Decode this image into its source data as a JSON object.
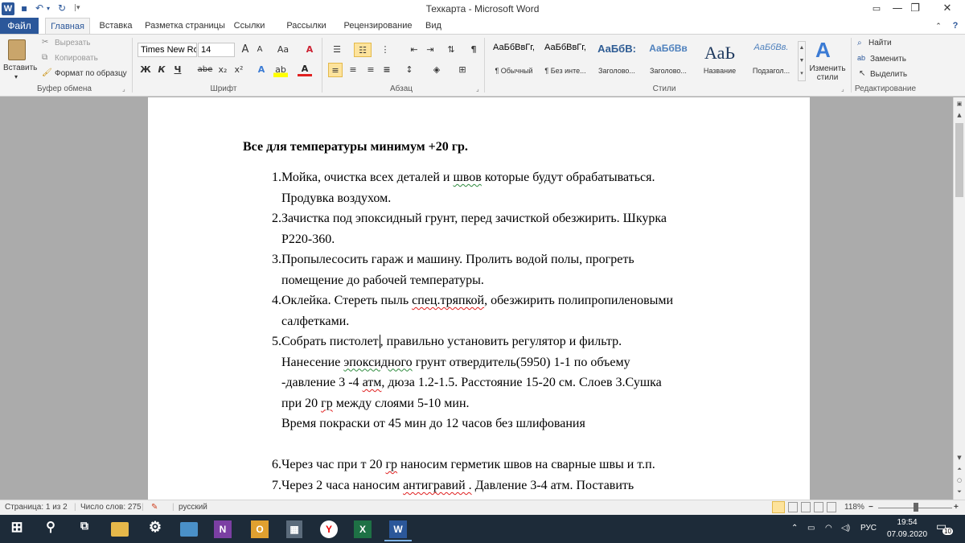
{
  "window": {
    "title": "Техкарта  -  Microsoft Word",
    "app_icon": "word-icon",
    "controls": {
      "help": "?",
      "minimize": "—",
      "restore": "❐",
      "close": "✕"
    }
  },
  "quick_access": {
    "save_icon": "save-icon",
    "undo_icon": "undo-icon",
    "redo_icon": "redo-icon"
  },
  "tabs": [
    "Файл",
    "Главная",
    "Вставка",
    "Разметка страницы",
    "Ссылки",
    "Рассылки",
    "Рецензирование",
    "Вид"
  ],
  "ribbon": {
    "clipboard": {
      "label": "Буфер обмена",
      "paste": "Вставить",
      "cut": "Вырезать",
      "copy": "Копировать",
      "format_painter": "Формат по образцу"
    },
    "font": {
      "label": "Шрифт",
      "font_name": "Times New Ro",
      "font_size": "14",
      "bold": "Ж",
      "italic": "К",
      "underline": "Ч",
      "strike": "abe",
      "subscript": "x₂",
      "superscript": "x²",
      "grow": "A",
      "shrink": "A",
      "case": "Aa",
      "clear": "A"
    },
    "paragraph": {
      "label": "Абзац"
    },
    "styles": {
      "label": "Стили",
      "items": [
        {
          "sample": "АаБбВвГг,",
          "name": "¶ Обычный"
        },
        {
          "sample": "АаБбВвГг,",
          "name": "¶ Без инте..."
        },
        {
          "sample": "АаБбВ:",
          "name": "Заголово..."
        },
        {
          "sample": "АаБбВв",
          "name": "Заголово..."
        },
        {
          "sample": "АаЬ",
          "name": "Название"
        },
        {
          "sample": "АаБбВв.",
          "name": "Подзагол..."
        }
      ],
      "change_styles": "Изменить стили"
    },
    "editing": {
      "label": "Редактирование",
      "find": "Найти",
      "replace": "Заменить",
      "select": "Выделить"
    }
  },
  "document": {
    "heading": "Все для температуры минимум +20 гр.",
    "items": [
      {
        "num": "1.",
        "lines": [
          "Мойка, очистка всех деталей и швов которые будут обрабатываться.",
          "Продувка воздухом."
        ]
      },
      {
        "num": "2.",
        "lines": [
          "Зачистка под эпоксидный грунт, перед зачисткой обезжирить. Шкурка",
          "P220-360."
        ]
      },
      {
        "num": "3.",
        "lines": [
          "Пропылесосить гараж и машину. Пролить водой полы, прогреть",
          "помещение до рабочей температуры."
        ]
      },
      {
        "num": "4.",
        "lines": [
          "Оклейка. Стереть пыль спец.тряпкой, обезжирить полипропиленовыми",
          "салфетками."
        ]
      },
      {
        "num": "5.",
        "lines": [
          "Собрать пистолет, правильно установить регулятор и фильтр.",
          "Нанесение эпоксидного грунт отвердитель(5950) 1-1 по объему",
          "-давление 3 -4 атм, дюза 1.2-1.5. Расстояние 15-20 см. Слоев 3.Сушка",
          "при 20 гр между слоями 5-10 мин.",
          "Время покраски от 45 мин до 12 часов без шлифования"
        ]
      },
      {
        "num": "6.",
        "lines": [
          "Через час при т 20 гр наносим герметик швов  на сварные швы и т.п."
        ]
      },
      {
        "num": "7.",
        "lines": [
          "Через 2 часа наносим антигравий . Давление 3-4 атм. Поставить"
        ]
      }
    ]
  },
  "status": {
    "page": "Страница: 1 из 2",
    "words": "Число слов: 275",
    "language": "русский",
    "zoom": "118%"
  },
  "taskbar": {
    "time": "19:54",
    "date": "07.09.2020",
    "lang": "РУС",
    "notifications": "10"
  }
}
